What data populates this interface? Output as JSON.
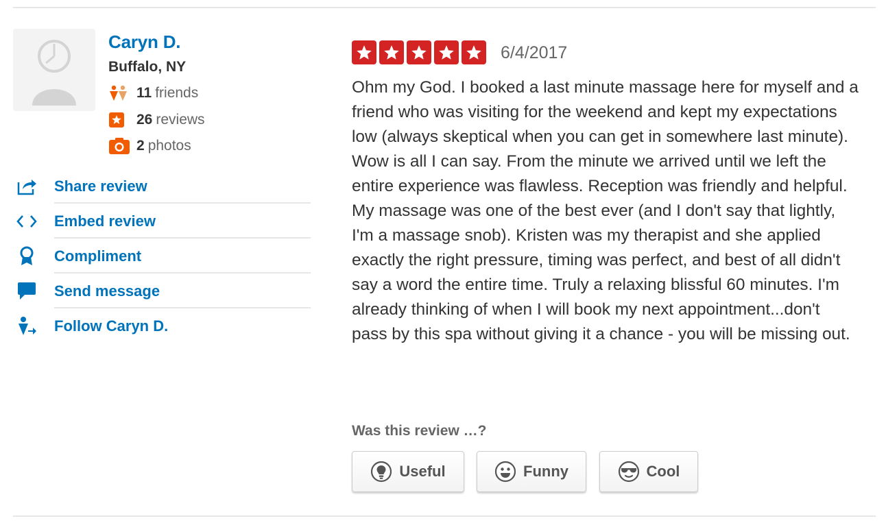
{
  "user": {
    "name": "Caryn D.",
    "location": "Buffalo, NY",
    "stats": [
      {
        "icon": "friends-icon",
        "count": "11",
        "label": "friends",
        "color": "#f15c00"
      },
      {
        "icon": "star-icon",
        "count": "26",
        "label": "reviews",
        "color": "#f15c00"
      },
      {
        "icon": "camera-icon",
        "count": "2",
        "label": "photos",
        "color": "#f15c00"
      }
    ]
  },
  "actions": [
    {
      "icon": "share-icon",
      "label": "Share review"
    },
    {
      "icon": "embed-icon",
      "label": "Embed review"
    },
    {
      "icon": "compliment-icon",
      "label": "Compliment"
    },
    {
      "icon": "message-icon",
      "label": "Send message"
    },
    {
      "icon": "follow-icon",
      "label": "Follow Caryn D."
    }
  ],
  "review": {
    "rating": 5,
    "rating_max": 5,
    "star_color": "#d32323",
    "date": "6/4/2017",
    "text": "Ohm my God. I booked a last minute massage here for myself and a friend who was visiting for the weekend and kept my expectations low (always skeptical when you can get in somewhere last minute). Wow is all I can say. From the minute we arrived until we left the entire experience was flawless. Reception was friendly and helpful. My massage was one of the best ever (and I don't say that lightly, I'm a massage snob). Kristen was my therapist and she applied exactly the right pressure, timing was perfect, and best of all didn't say a word the entire time. Truly a relaxing blissful 60 minutes. I'm already thinking of when I will book my next appointment...don't pass by this spa without giving it a chance - you will be missing out."
  },
  "votes": {
    "question": "Was this review …?",
    "buttons": [
      {
        "icon": "lightbulb-icon",
        "label": "Useful"
      },
      {
        "icon": "smiley-icon",
        "label": "Funny"
      },
      {
        "icon": "sunglasses-icon",
        "label": "Cool"
      }
    ]
  },
  "colors": {
    "link": "#0073bb",
    "accent": "#f15c00",
    "divider": "#e6e6e6"
  }
}
